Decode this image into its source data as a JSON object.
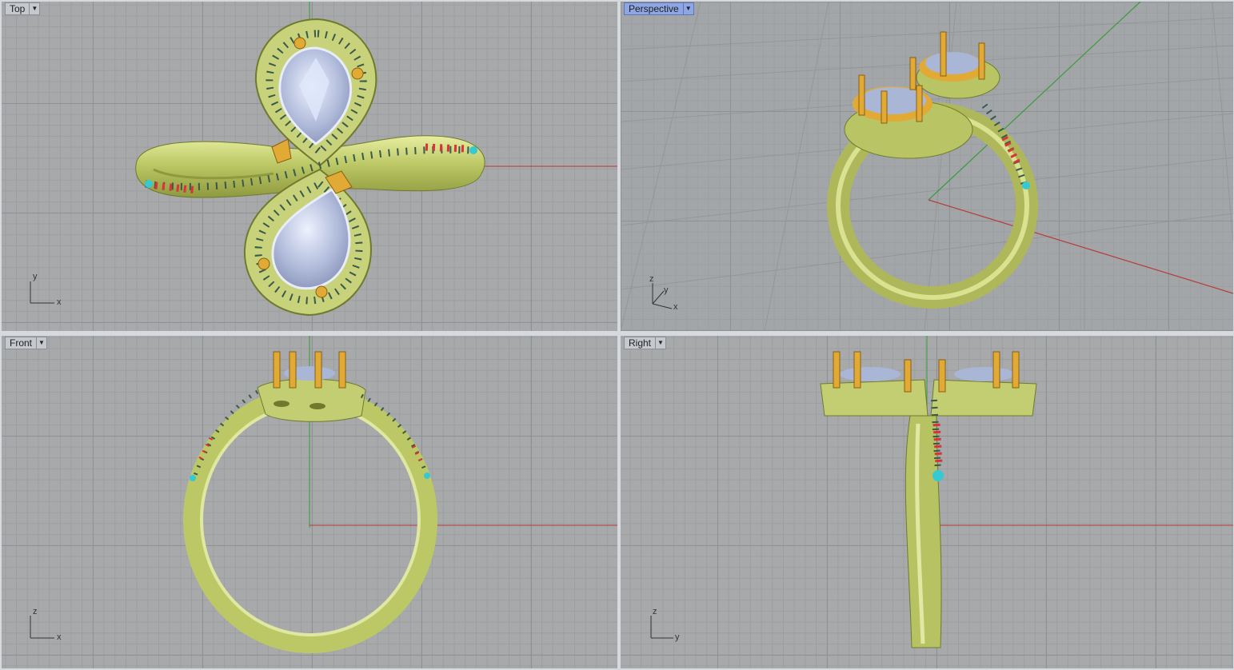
{
  "viewports": {
    "top": {
      "label": "Top",
      "axis_h": "x",
      "axis_v": "y"
    },
    "persp": {
      "label": "Perspective",
      "axis_a": "z",
      "axis_b": "y",
      "axis_c": "x"
    },
    "front": {
      "label": "Front",
      "axis_h": "x",
      "axis_v": "z"
    },
    "right": {
      "label": "Right",
      "axis_h": "y",
      "axis_v": "z"
    }
  },
  "dropdown_glyph": "▼",
  "colors": {
    "gold": "#c3cf6b",
    "prong": "#e0aa35",
    "stone": "#b7c6e8",
    "pave": "#3f6a5b",
    "ruby": "#d8343a",
    "topaz": "#36c8d3",
    "x_axis": "#b53b3b",
    "y_axis": "#3a9c3a",
    "active_tab": "#8fa6e4"
  }
}
